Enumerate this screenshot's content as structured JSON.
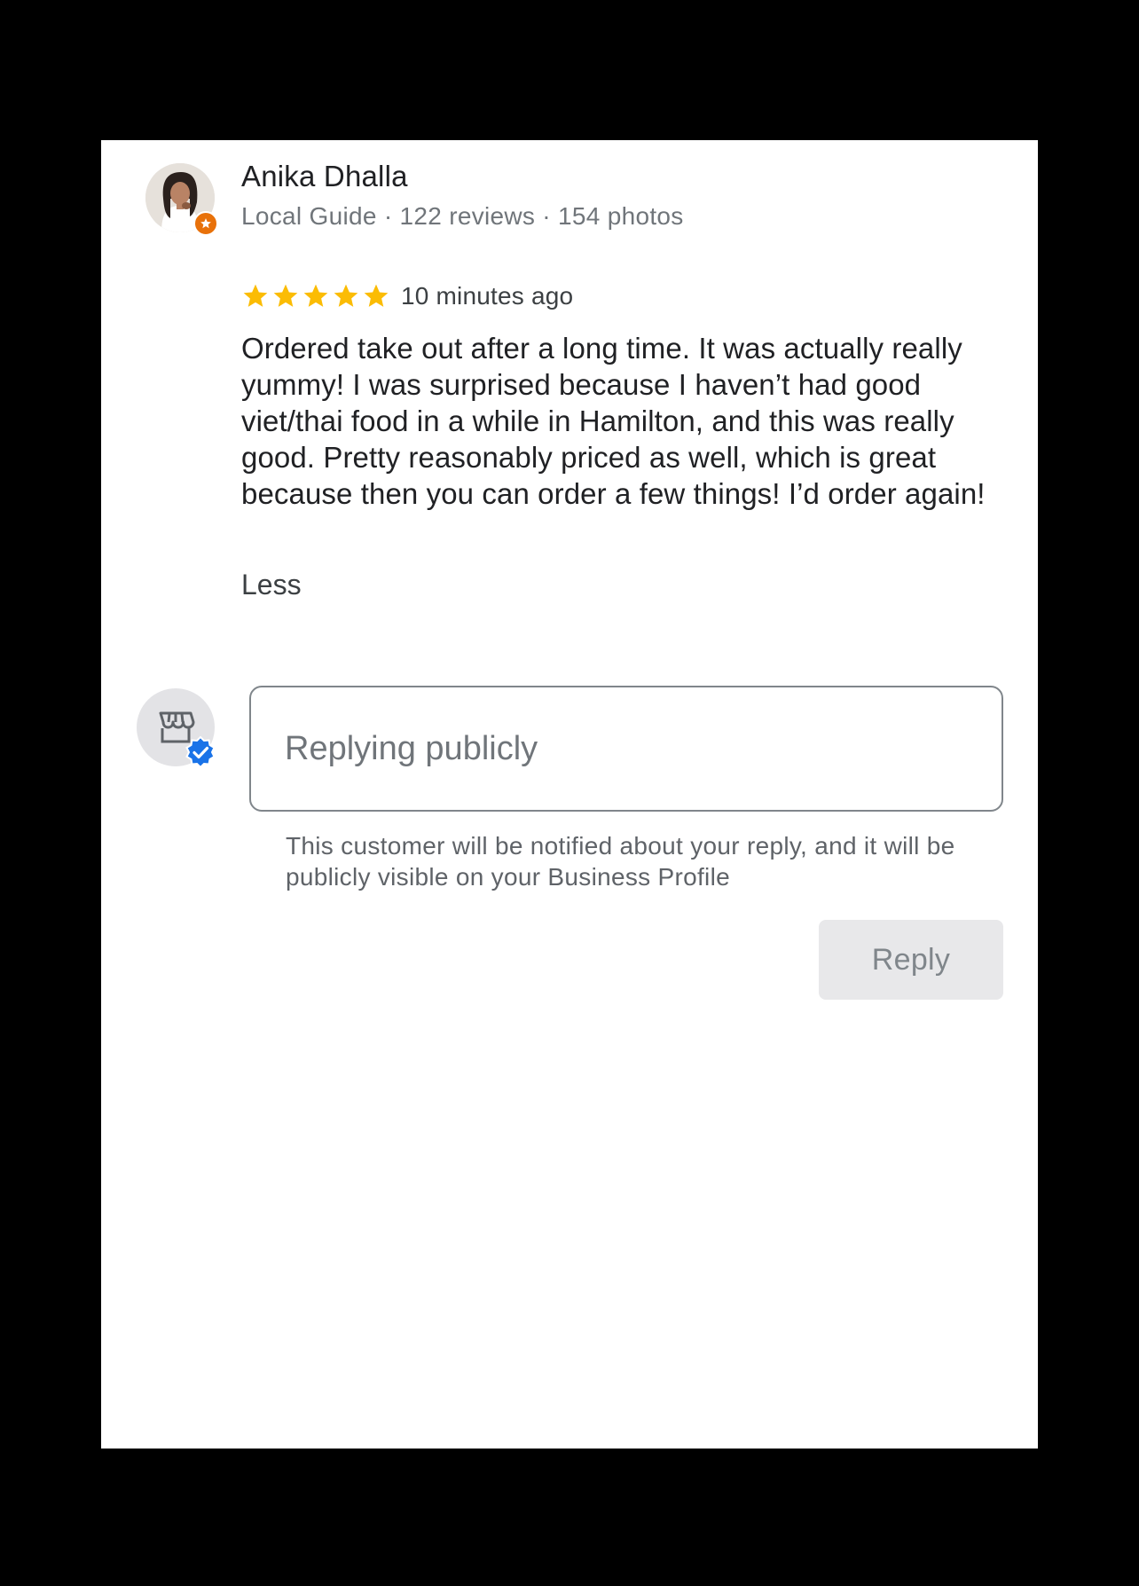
{
  "reviewer": {
    "name": "Anika Dhalla",
    "meta": "Local Guide · 122 reviews · 154 photos",
    "avatar_icon": "profile-photo",
    "badge_icon": "local-guide-star-icon"
  },
  "review": {
    "rating": 5,
    "rating_max": 5,
    "time_ago": "10 minutes ago",
    "text": "Ordered take out after a long time. It was actually really yummy! I was surprised because I haven’t had good viet/thai food in a while in Hamilton, and this was really good. Pretty reasonably priced as well, which is great because then you can order a few things! I’d order again!",
    "less_label": "Less"
  },
  "reply": {
    "business_icon": "storefront-icon",
    "verified_icon": "verified-check-icon",
    "placeholder": "Replying publicly",
    "value": "",
    "notice": "This customer will be notified about your reply, and it will be publicly visible on your Business Profile",
    "button_label": "Reply"
  },
  "colors": {
    "star": "#fbbc04",
    "guide_badge": "#e8710a",
    "verified": "#1a73e8",
    "button_bg": "#e8e8ea",
    "button_text": "#80868b"
  }
}
